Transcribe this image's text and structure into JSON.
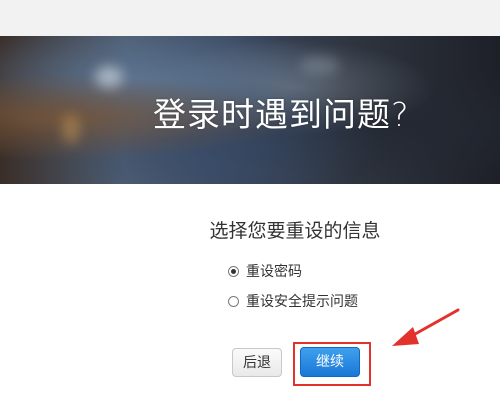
{
  "hero": {
    "title": "登录时遇到问题?"
  },
  "form": {
    "prompt": "选择您要重设的信息",
    "options": [
      {
        "label": "重设密码",
        "selected": true
      },
      {
        "label": "重设安全提示问题",
        "selected": false
      }
    ],
    "back_label": "后退",
    "continue_label": "继续"
  },
  "annotation": {
    "color": "#e3312c",
    "target": "continue-button"
  },
  "colors": {
    "primary_button": "#1a78d6",
    "highlight": "#e3312c"
  }
}
